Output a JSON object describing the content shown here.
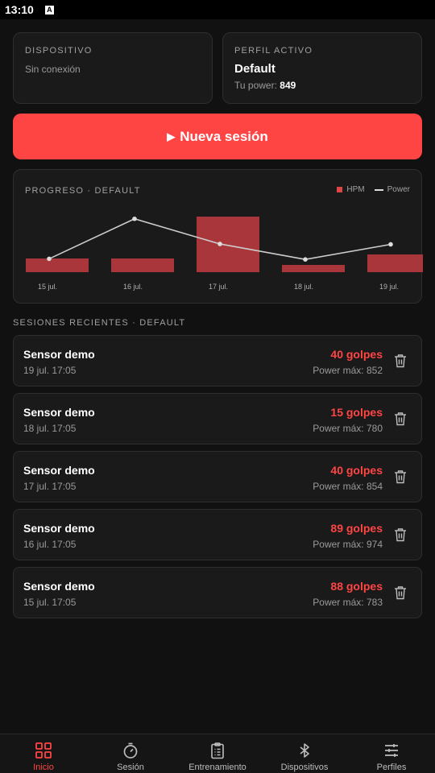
{
  "status": {
    "time": "13:10",
    "icon": "A"
  },
  "device_card": {
    "label": "DISPOSITIVO",
    "status": "Sin conexión"
  },
  "profile_card": {
    "label": "PERFIL ACTIVO",
    "name": "Default",
    "power_label": "Tu power:",
    "power_value": "849"
  },
  "new_session": {
    "icon": "play-icon",
    "label": "Nueva sesión"
  },
  "progress": {
    "title": "PROGRESO · DEFAULT",
    "legend_bar": "HPM",
    "legend_line": "Power"
  },
  "chart_data": {
    "type": "bar",
    "categories": [
      "15 jul.",
      "16 jul.",
      "17 jul.",
      "18 jul.",
      "19 jul."
    ],
    "series": [
      {
        "name": "HPM",
        "type": "bar",
        "values": [
          17,
          17,
          69,
          9,
          22
        ],
        "color": "#a8363a"
      },
      {
        "name": "Power",
        "type": "line",
        "values": [
          783,
          974,
          854,
          780,
          852
        ],
        "color": "#cccccc"
      }
    ],
    "grid": false,
    "legend": "top-right"
  },
  "recent": {
    "title": "SESIONES RECIENTES · DEFAULT",
    "items": [
      {
        "name": "Sensor demo",
        "date": "19 jul. 17:05",
        "hits": "40 golpes",
        "power": "Power máx: 852"
      },
      {
        "name": "Sensor demo",
        "date": "18 jul. 17:05",
        "hits": "15 golpes",
        "power": "Power máx: 780"
      },
      {
        "name": "Sensor demo",
        "date": "17 jul. 17:05",
        "hits": "40 golpes",
        "power": "Power máx: 854"
      },
      {
        "name": "Sensor demo",
        "date": "16 jul. 17:05",
        "hits": "89 golpes",
        "power": "Power máx: 974"
      },
      {
        "name": "Sensor demo",
        "date": "15 jul. 17:05",
        "hits": "88 golpes",
        "power": "Power máx: 783"
      }
    ]
  },
  "nav": [
    {
      "label": "Inicio",
      "icon": "grid-icon",
      "active": true
    },
    {
      "label": "Sesión",
      "icon": "stopwatch-icon",
      "active": false
    },
    {
      "label": "Entrenamiento",
      "icon": "clipboard-icon",
      "active": false
    },
    {
      "label": "Dispositivos",
      "icon": "bluetooth-icon",
      "active": false
    },
    {
      "label": "Perfiles",
      "icon": "sliders-icon",
      "active": false
    }
  ],
  "colors": {
    "accent": "#ff4444",
    "bar": "#a8363a",
    "background": "#111111",
    "card": "#1a1a1a"
  }
}
